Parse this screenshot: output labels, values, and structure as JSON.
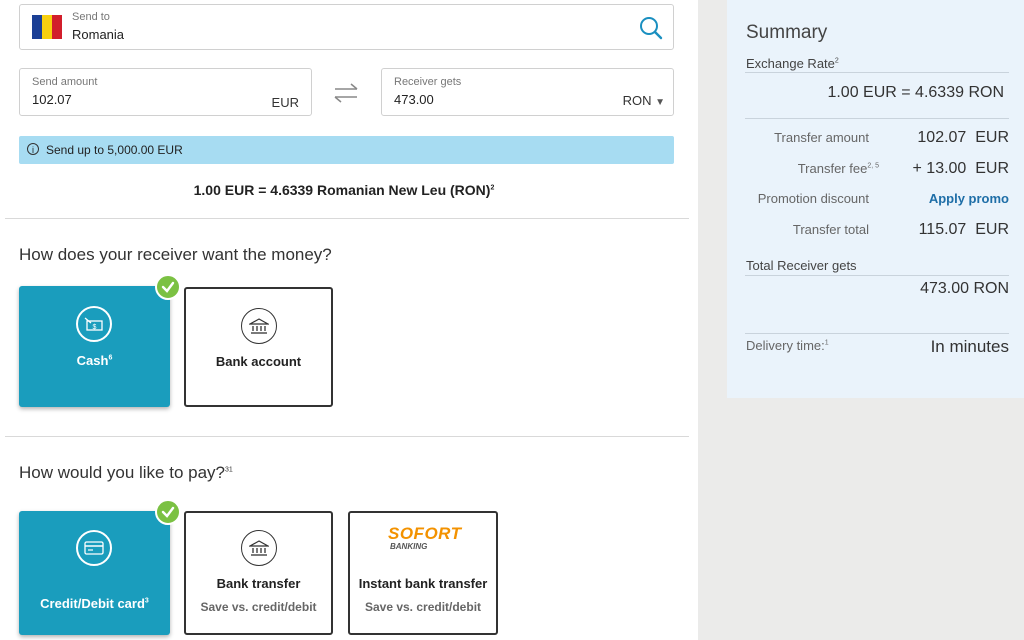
{
  "destination": {
    "label": "Send to",
    "value": "Romania"
  },
  "send": {
    "label": "Send amount",
    "value": "102.07",
    "currency": "EUR"
  },
  "receive": {
    "label": "Receiver gets",
    "value": "473.00",
    "currency": "RON"
  },
  "info": {
    "icon_glyph": "i",
    "text": "Send up to 5,000.00 EUR"
  },
  "rate_text": "1.00 EUR = 4.6339 Romanian New Leu (RON)",
  "rate_sup": "2",
  "receive_section": {
    "question": "How does your receiver want the money?",
    "options": [
      {
        "title": "Cash",
        "sup": "6",
        "icon": "cash-icon",
        "selected": true
      },
      {
        "title": "Bank account",
        "sup": "",
        "icon": "bank-icon",
        "selected": false
      }
    ]
  },
  "pay_section": {
    "question": "How would you like to pay?",
    "question_sup": "31",
    "options": [
      {
        "title": "Credit/Debit card",
        "sup": "3",
        "subtitle": "",
        "icon": "credit-card-icon",
        "selected": true
      },
      {
        "title": "Bank transfer",
        "sup": "",
        "subtitle": "Save vs. credit/debit",
        "icon": "bank-icon",
        "selected": false
      },
      {
        "title": "Instant bank transfer",
        "sup": "",
        "subtitle": "Save vs. credit/debit",
        "icon": "sofort-logo",
        "logo_text": "SOFORT",
        "logo_sub": "BANKING",
        "selected": false
      }
    ]
  },
  "summary": {
    "title": "Summary",
    "exchange_rate_label": "Exchange Rate",
    "exchange_rate_sup": "2",
    "exchange_rate_value": "1.00 EUR = 4.6339 RON",
    "transfer_amount_label": "Transfer amount",
    "transfer_amount_value": "102.07  EUR",
    "transfer_fee_label": "Transfer fee",
    "transfer_fee_sup": "2, 5",
    "transfer_fee_value": "+ 13.00  EUR",
    "promo_label": "Promotion discount",
    "promo_link": "Apply promo",
    "total_label": "Transfer total",
    "total_value": "115.07  EUR",
    "receiver_gets_label": "Total Receiver gets",
    "receiver_gets_value": "473.00 RON",
    "delivery_label": "Delivery time:",
    "delivery_sup": "1",
    "delivery_value": "In minutes"
  },
  "colors": {
    "accent": "#1a9dbd",
    "check": "#7bc143",
    "info_bar": "#a7dcf2",
    "summary_bg": "#eaf3fb",
    "link": "#1e6ea7"
  }
}
